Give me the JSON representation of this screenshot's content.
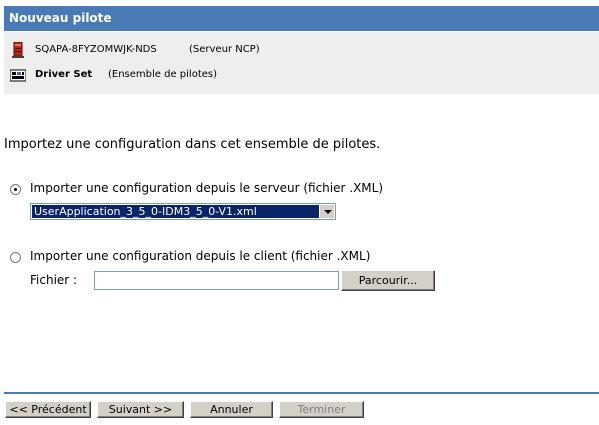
{
  "header": {
    "title": "Nouveau pilote"
  },
  "context": {
    "server": {
      "icon": "server-icon",
      "name": "SQAPA-8FYZOMWJK-NDS",
      "type": "(Serveur NCP)"
    },
    "driver_set": {
      "icon": "driver-set-icon",
      "name": "Driver Set",
      "type": "(Ensemble de pilotes)"
    }
  },
  "main": {
    "intro": "Importez une configuration dans cet ensemble de pilotes.",
    "option_server": {
      "label": "Importer une configuration depuis le serveur (fichier .XML)",
      "selected": true,
      "dropdown_value": "UserApplication_3_5_0-IDM3_5_0-V1.xml"
    },
    "option_client": {
      "label": "Importer une configuration depuis le client (fichier .XML)",
      "selected": false,
      "file_label": "Fichier :",
      "file_value": "",
      "browse_label": "Parcourir..."
    }
  },
  "footer": {
    "prev_label": "<< Précédent",
    "next_label": "Suivant >>",
    "cancel_label": "Annuler",
    "finish_label": "Terminer",
    "finish_enabled": false
  },
  "colors": {
    "header_bg": "#4a7ab5",
    "panel_bg": "#eeeeee",
    "selection_bg": "#0a246a",
    "button_face": "#d4d0c8"
  }
}
